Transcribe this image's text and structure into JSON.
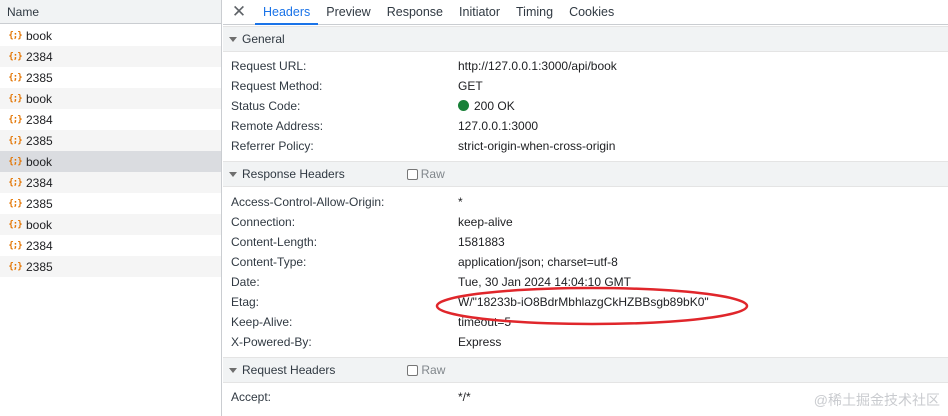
{
  "left_panel": {
    "header": "Name",
    "requests": [
      {
        "name": "book"
      },
      {
        "name": "2384"
      },
      {
        "name": "2385"
      },
      {
        "name": "book"
      },
      {
        "name": "2384"
      },
      {
        "name": "2385"
      },
      {
        "name": "book"
      },
      {
        "name": "2384"
      },
      {
        "name": "2385"
      },
      {
        "name": "book"
      },
      {
        "name": "2384"
      },
      {
        "name": "2385"
      }
    ],
    "selected_index": 6,
    "icon_glyph": "{;}"
  },
  "tabs": {
    "close_glyph": "✕",
    "items": [
      "Headers",
      "Preview",
      "Response",
      "Initiator",
      "Timing",
      "Cookies"
    ],
    "active": "Headers"
  },
  "general": {
    "title": "General",
    "rows": [
      {
        "key": "Request URL:",
        "value": "http://127.0.0.1:3000/api/book"
      },
      {
        "key": "Request Method:",
        "value": "GET"
      },
      {
        "key": "Status Code:",
        "value": "200 OK"
      },
      {
        "key": "Remote Address:",
        "value": "127.0.0.1:3000"
      },
      {
        "key": "Referrer Policy:",
        "value": "strict-origin-when-cross-origin"
      }
    ]
  },
  "response_headers": {
    "title": "Response Headers",
    "raw_label": "Raw",
    "rows": [
      {
        "key": "Access-Control-Allow-Origin:",
        "value": "*"
      },
      {
        "key": "Connection:",
        "value": "keep-alive"
      },
      {
        "key": "Content-Length:",
        "value": "1581883"
      },
      {
        "key": "Content-Type:",
        "value": "application/json; charset=utf-8"
      },
      {
        "key": "Date:",
        "value": "Tue, 30 Jan 2024 14:04:10 GMT"
      },
      {
        "key": "Etag:",
        "value": "W/\"18233b-iO8BdrMbhlazgCkHZBBsgb89bK0\""
      },
      {
        "key": "Keep-Alive:",
        "value": "timeout=5"
      },
      {
        "key": "X-Powered-By:",
        "value": "Express"
      }
    ]
  },
  "request_headers": {
    "title": "Request Headers",
    "raw_label": "Raw",
    "rows": [
      {
        "key": "Accept:",
        "value": "*/*"
      }
    ]
  },
  "colors": {
    "accent": "#1a73e8",
    "status_ok": "#188038",
    "annotation": "#e0262b"
  },
  "watermark": "@稀土掘金技术社区"
}
